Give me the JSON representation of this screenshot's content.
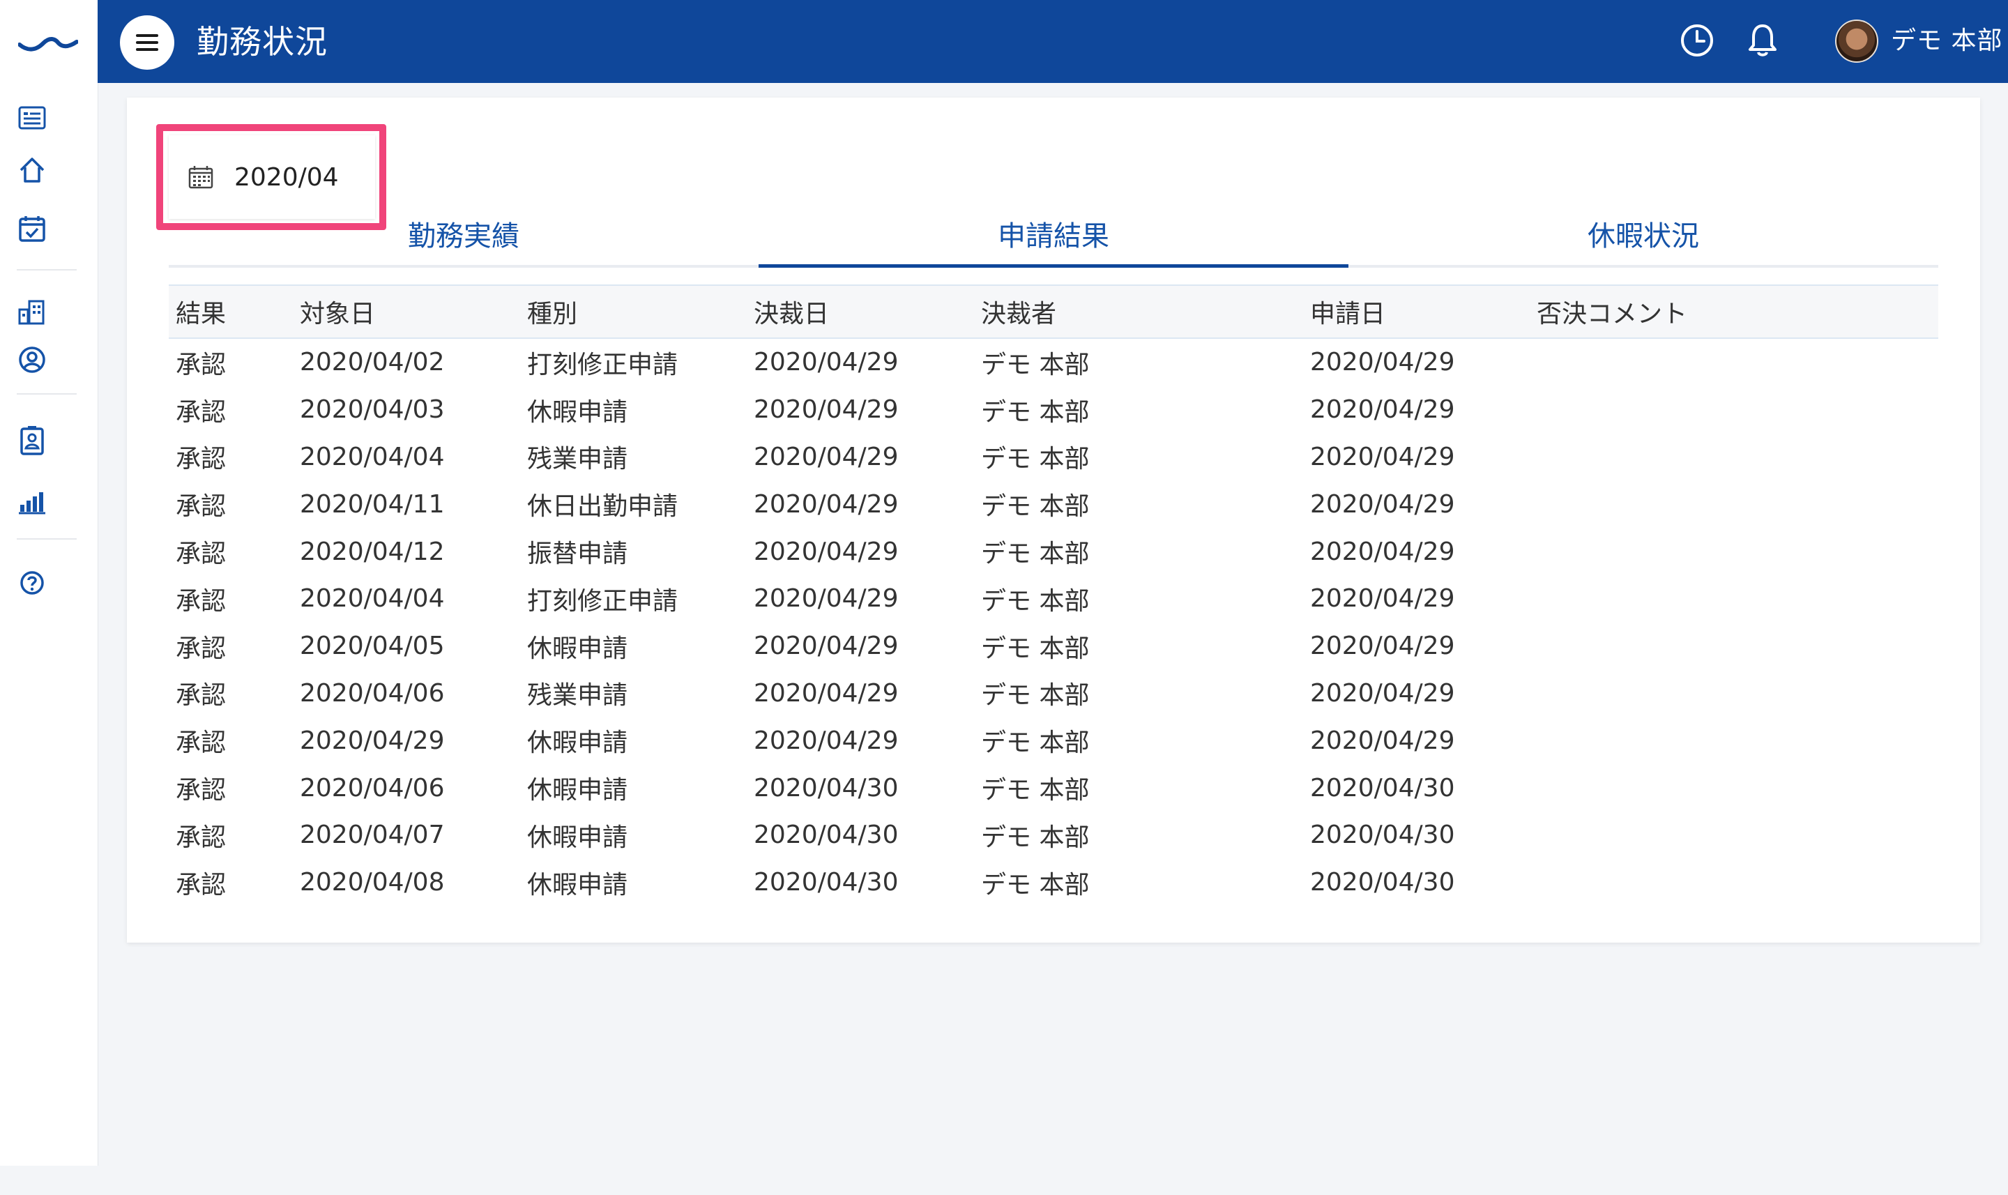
{
  "header": {
    "title": "勤務状況",
    "user_name": "デモ 本部"
  },
  "sidebar": {
    "items": [
      {
        "icon": "list-icon"
      },
      {
        "icon": "home-icon"
      },
      {
        "icon": "calendar-check-icon"
      },
      {
        "icon": "building-icon"
      },
      {
        "icon": "user-circle-icon"
      },
      {
        "icon": "id-badge-icon"
      },
      {
        "icon": "bar-chart-icon"
      },
      {
        "icon": "help-icon"
      }
    ]
  },
  "date_picker": {
    "value": "2020/04"
  },
  "tabs": [
    {
      "label": "勤務実績",
      "active": false
    },
    {
      "label": "申請結果",
      "active": true
    },
    {
      "label": "休暇状況",
      "active": false
    }
  ],
  "table": {
    "headers": [
      "結果",
      "対象日",
      "種別",
      "決裁日",
      "決裁者",
      "申請日",
      "否決コメント"
    ],
    "rows": [
      [
        "承認",
        "2020/04/02",
        "打刻修正申請",
        "2020/04/29",
        "デモ 本部",
        "2020/04/29",
        ""
      ],
      [
        "承認",
        "2020/04/03",
        "休暇申請",
        "2020/04/29",
        "デモ 本部",
        "2020/04/29",
        ""
      ],
      [
        "承認",
        "2020/04/04",
        "残業申請",
        "2020/04/29",
        "デモ 本部",
        "2020/04/29",
        ""
      ],
      [
        "承認",
        "2020/04/11",
        "休日出勤申請",
        "2020/04/29",
        "デモ 本部",
        "2020/04/29",
        ""
      ],
      [
        "承認",
        "2020/04/12",
        "振替申請",
        "2020/04/29",
        "デモ 本部",
        "2020/04/29",
        ""
      ],
      [
        "承認",
        "2020/04/04",
        "打刻修正申請",
        "2020/04/29",
        "デモ 本部",
        "2020/04/29",
        ""
      ],
      [
        "承認",
        "2020/04/05",
        "休暇申請",
        "2020/04/29",
        "デモ 本部",
        "2020/04/29",
        ""
      ],
      [
        "承認",
        "2020/04/06",
        "残業申請",
        "2020/04/29",
        "デモ 本部",
        "2020/04/29",
        ""
      ],
      [
        "承認",
        "2020/04/29",
        "休暇申請",
        "2020/04/29",
        "デモ 本部",
        "2020/04/29",
        ""
      ],
      [
        "承認",
        "2020/04/06",
        "休暇申請",
        "2020/04/30",
        "デモ 本部",
        "2020/04/30",
        ""
      ],
      [
        "承認",
        "2020/04/07",
        "休暇申請",
        "2020/04/30",
        "デモ 本部",
        "2020/04/30",
        ""
      ],
      [
        "承認",
        "2020/04/08",
        "休暇申請",
        "2020/04/30",
        "デモ 本部",
        "2020/04/30",
        ""
      ]
    ]
  },
  "colors": {
    "header_bg": "#0f479a",
    "tab_text": "#1553a8",
    "highlight": "#f0447a"
  }
}
